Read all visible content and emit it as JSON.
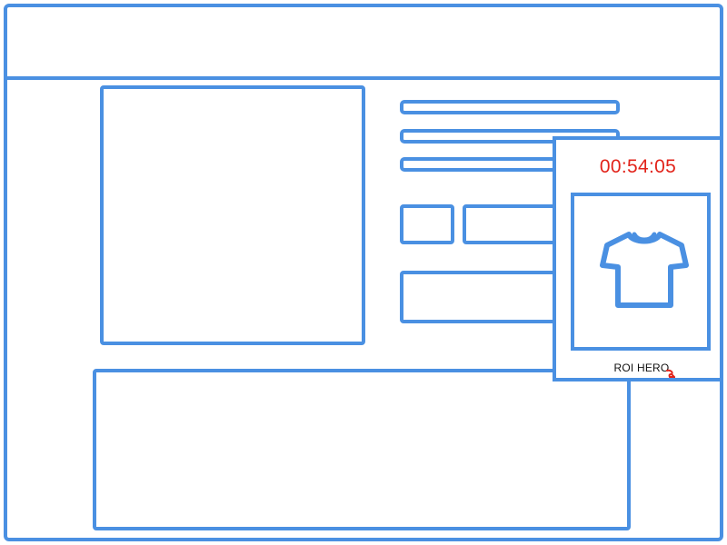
{
  "widget": {
    "timer": "00:54:05",
    "brand": "ROI HERO",
    "product_icon": "t-shirt-icon",
    "brand_mark_icon": "red-swoosh-icon"
  },
  "colors": {
    "wireframe_blue": "#4a90e2",
    "timer_red": "#e2231a"
  }
}
